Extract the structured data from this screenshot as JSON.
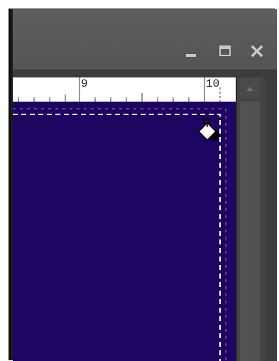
{
  "window": {
    "controls": {
      "minimize_icon": "minimize-icon",
      "maximize_icon": "maximize-icon",
      "close_icon": "close-icon"
    }
  },
  "ruler": {
    "labels": [
      "9",
      "10"
    ]
  },
  "canvas": {
    "fill_color": "#1d0561",
    "cursor_icon": "paint-bucket-icon"
  },
  "scrollbar": {
    "up_icon": "scroll-up-arrow-icon"
  },
  "colors": {
    "titlebar": "#585858",
    "panel": "#3c3c3c",
    "canvas": "#1d0561",
    "marquee": "#ffffff"
  }
}
